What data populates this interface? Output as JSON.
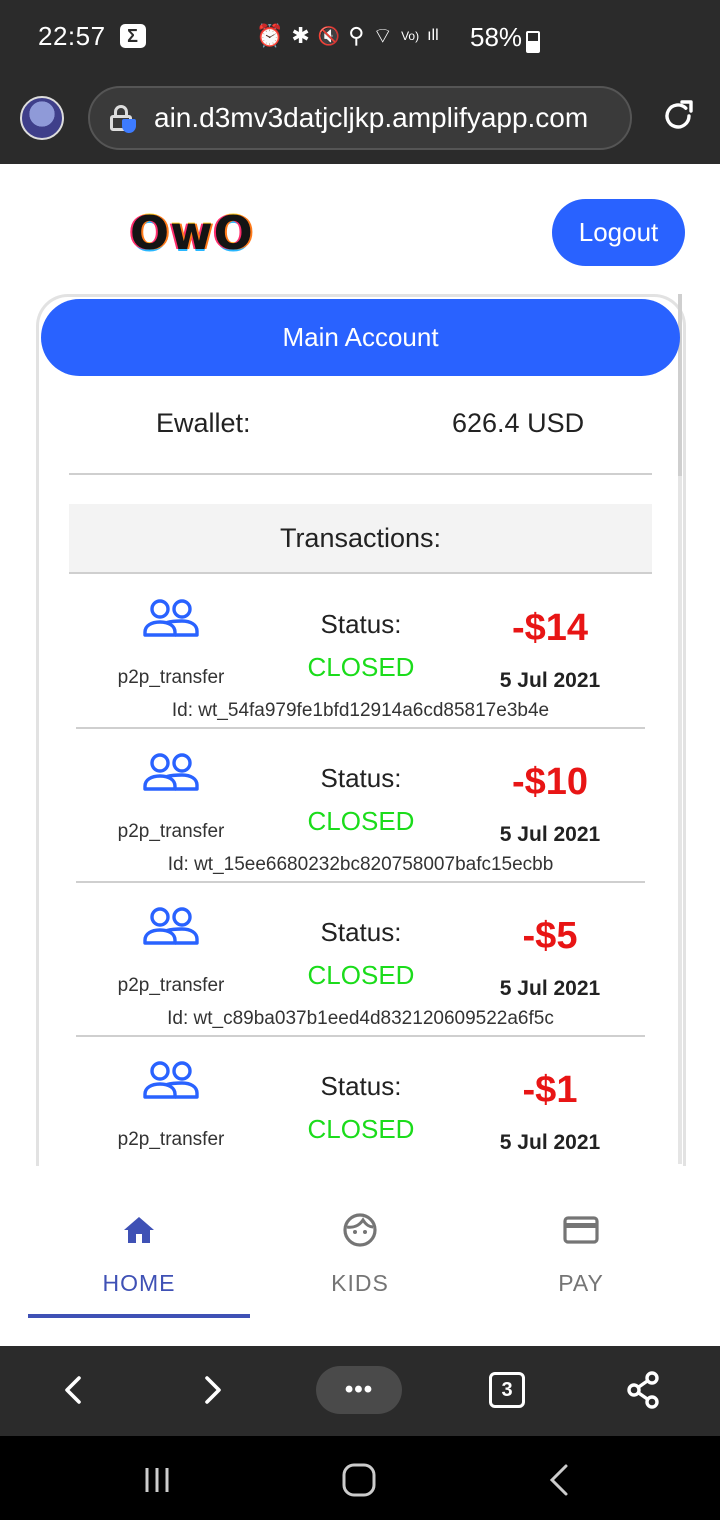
{
  "status_bar": {
    "time": "22:57",
    "notification_glyph": "Σ",
    "icons": [
      "alarm-icon",
      "bluetooth-icon",
      "mute-icon",
      "location-icon",
      "wifi-icon",
      "volte-icon",
      "signal-icon"
    ],
    "icon_glyphs": [
      "⏰",
      "✱",
      "🔇",
      "⚲",
      "⌔",
      "Vo)",
      "ıll"
    ],
    "battery": "58%"
  },
  "browser": {
    "url": "ain.d3mv3datjcljkp.amplifyapp.com",
    "tab_count": "3",
    "more_label": "•••"
  },
  "app": {
    "logo": "OwO",
    "logout_label": "Logout",
    "account_title": "Main Account",
    "ewallet_label": "Ewallet:",
    "ewallet_value": "626.4 USD",
    "transactions_label": "Transactions:",
    "transactions": [
      {
        "type": "p2p_transfer",
        "status_label": "Status:",
        "status": "CLOSED",
        "amount": "-$14",
        "date": "5 Jul 2021",
        "id": "Id: wt_54fa979fe1bfd12914a6cd85817e3b4e"
      },
      {
        "type": "p2p_transfer",
        "status_label": "Status:",
        "status": "CLOSED",
        "amount": "-$10",
        "date": "5 Jul 2021",
        "id": "Id: wt_15ee6680232bc820758007bafc15ecbb"
      },
      {
        "type": "p2p_transfer",
        "status_label": "Status:",
        "status": "CLOSED",
        "amount": "-$5",
        "date": "5 Jul 2021",
        "id": "Id: wt_c89ba037b1eed4d832120609522a6f5c"
      },
      {
        "type": "p2p_transfer",
        "status_label": "Status:",
        "status": "CLOSED",
        "amount": "-$1",
        "date": "5 Jul 2021",
        "id": ""
      }
    ]
  },
  "bottom_nav": {
    "items": [
      {
        "label": "HOME",
        "icon": "home-icon",
        "active": true
      },
      {
        "label": "KIDS",
        "icon": "face-icon",
        "active": false
      },
      {
        "label": "PAY",
        "icon": "credit-card-icon",
        "active": false
      }
    ]
  },
  "colors": {
    "primary": "#2962ff",
    "nav_active": "#3f51b5",
    "nav_inactive": "#757575",
    "status_closed": "#1bdc1b",
    "amount_negative": "#e81515"
  }
}
